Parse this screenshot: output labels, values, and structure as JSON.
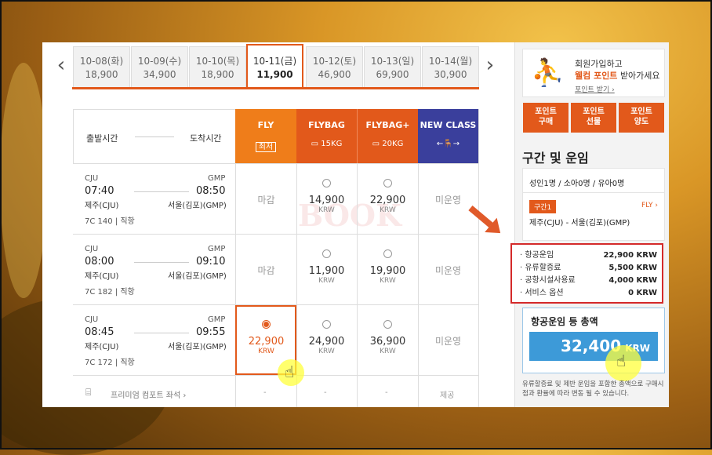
{
  "nav": {
    "prev_icon": "‹",
    "next_icon": "›"
  },
  "dates": [
    {
      "date": "10-08(화)",
      "price": "18,900"
    },
    {
      "date": "10-09(수)",
      "price": "34,900"
    },
    {
      "date": "10-10(목)",
      "price": "18,900"
    },
    {
      "date": "10-11(금)",
      "price": "11,900"
    },
    {
      "date": "10-12(토)",
      "price": "46,900"
    },
    {
      "date": "10-13(일)",
      "price": "69,900"
    },
    {
      "date": "10-14(월)",
      "price": "30,900"
    }
  ],
  "header": {
    "depart": "출발시간",
    "arrive": "도착시간",
    "fly": "FLY",
    "fly_badge": "최저",
    "flybag": "FLYBAG",
    "flybag_sub": "15KG",
    "flybagplus": "FLYBAG+",
    "flybagplus_sub": "20KG",
    "newclass": "NEW CLASS",
    "newclass_sub": "←🪑→"
  },
  "flights": [
    {
      "from_code": "CJU",
      "to_code": "GMP",
      "dep": "07:40",
      "arr": "08:50",
      "from": "제주(CJU)",
      "to": "서울(김포)(GMP)",
      "no": "7C 140",
      "type": "직항",
      "fly": "마감",
      "flybag": "14,900",
      "flybagplus": "22,900",
      "newclass": "미운영"
    },
    {
      "from_code": "CJU",
      "to_code": "GMP",
      "dep": "08:00",
      "arr": "09:10",
      "from": "제주(CJU)",
      "to": "서울(김포)(GMP)",
      "no": "7C 182",
      "type": "직항",
      "fly": "마감",
      "flybag": "11,900",
      "flybagplus": "19,900",
      "newclass": "미운영"
    },
    {
      "from_code": "CJU",
      "to_code": "GMP",
      "dep": "08:45",
      "arr": "09:55",
      "from": "제주(CJU)",
      "to": "서울(김포)(GMP)",
      "no": "7C 172",
      "type": "직항",
      "fly": "22,900",
      "flybag": "24,900",
      "flybagplus": "36,900",
      "newclass": "미운영"
    }
  ],
  "krw": "KRW",
  "premium": {
    "label": "프리미엄 컴포트 좌석 ›",
    "dash": "-",
    "offer": "제공"
  },
  "watermark": "BOOK",
  "side": {
    "join_line1": "회원가입하고",
    "join_highlight": "웰컴 포인트",
    "join_line2": "받아가세요",
    "point_link": "포인트 받기 ›",
    "buttons": [
      "포인트\n구매",
      "포인트\n선물",
      "포인트\n양도"
    ],
    "section_title": "구간 및 운임",
    "pax": "성인1명 / 소아0명 / 유아0명",
    "segment_badge": "구간1",
    "fare_class": "FLY ›",
    "route": "제주(CJU) - 서울(김포)(GMP)",
    "fees": [
      {
        "label": "· 항공운임",
        "value": "22,900 KRW"
      },
      {
        "label": "· 유류할증료",
        "value": "5,500 KRW"
      },
      {
        "label": "· 공항시설사용료",
        "value": "4,000 KRW"
      },
      {
        "label": "· 서비스 옵션",
        "value": "0 KRW"
      }
    ],
    "total_label": "항공운임 등 총액",
    "total": "32,400",
    "total_unit": "KRW",
    "note": "유류할증료 및 제반 운임을 포함한 총액으로 구매시점과 환율에 따라 변동 될 수 있습니다."
  },
  "colors": {
    "accent": "#e2591b",
    "fly": "#ef7d1a",
    "flybag": "#e2591b",
    "newclass": "#3a3f9c",
    "total": "#3d9ad8"
  }
}
